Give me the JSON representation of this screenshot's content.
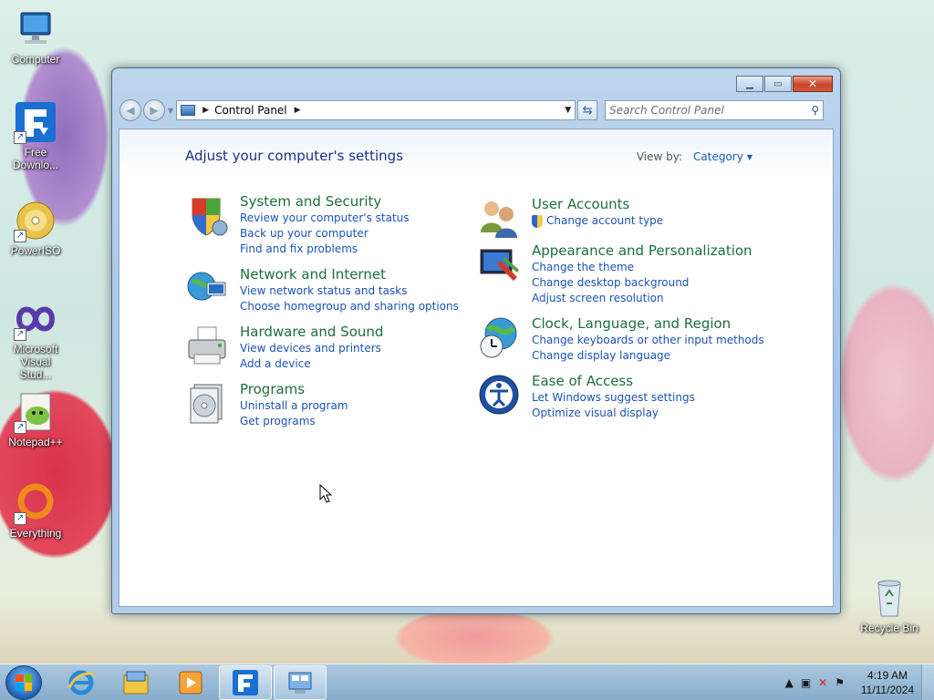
{
  "desktop": {
    "icons": [
      {
        "label": "Computer",
        "icon": "computer-icon"
      },
      {
        "label": "Free\nDownlo...",
        "icon": "free-download-manager-icon"
      },
      {
        "label": "PowerISO",
        "icon": "poweriso-icon"
      },
      {
        "label": "Microsoft\nVisual Stud...",
        "icon": "visual-studio-icon"
      },
      {
        "label": "Notepad++",
        "icon": "notepad-plus-plus-icon"
      },
      {
        "label": "Everything",
        "icon": "everything-search-icon"
      }
    ],
    "recycle_bin": {
      "label": "Recycle Bin",
      "icon": "recycle-bin-icon"
    }
  },
  "window": {
    "caption_buttons": {
      "minimize": "minimize-icon",
      "maximize": "maximize-icon",
      "close": "close-icon"
    },
    "address": {
      "crumb": "Control Panel"
    },
    "search": {
      "placeholder": "Search Control Panel"
    },
    "heading": "Adjust your computer's settings",
    "view_by": {
      "label": "View by:",
      "value": "Category"
    },
    "categories_left": [
      {
        "title": "System and Security",
        "icon": "shield-icon",
        "links": [
          "Review your computer's status",
          "Back up your computer",
          "Find and fix problems"
        ]
      },
      {
        "title": "Network and Internet",
        "icon": "network-globe-icon",
        "links": [
          "View network status and tasks",
          "Choose homegroup and sharing options"
        ]
      },
      {
        "title": "Hardware and Sound",
        "icon": "printer-icon",
        "links": [
          "View devices and printers",
          "Add a device"
        ]
      },
      {
        "title": "Programs",
        "icon": "programs-disc-icon",
        "links": [
          "Uninstall a program",
          "Get programs"
        ]
      }
    ],
    "categories_right": [
      {
        "title": "User Accounts",
        "icon": "users-icon",
        "links": [
          "Change account type"
        ]
      },
      {
        "title": "Appearance and Personalization",
        "icon": "monitor-palette-icon",
        "links": [
          "Change the theme",
          "Change desktop background",
          "Adjust screen resolution"
        ]
      },
      {
        "title": "Clock, Language, and Region",
        "icon": "globe-clock-icon",
        "links": [
          "Change keyboards or other input methods",
          "Change display language"
        ]
      },
      {
        "title": "Ease of Access",
        "icon": "ease-of-access-icon",
        "links": [
          "Let Windows suggest settings",
          "Optimize visual display"
        ]
      }
    ]
  },
  "taskbar": {
    "start": "windows-start-icon",
    "pinned": [
      "internet-explorer-icon",
      "file-explorer-icon",
      "media-player-icon",
      "free-download-manager-icon",
      "control-panel-icon"
    ],
    "clock": {
      "time": "4:19 AM",
      "date": "11/11/2024"
    }
  },
  "colors": {
    "link": "#1a53b5",
    "category_title": "#1e6e3c",
    "heading": "#1e3287"
  }
}
